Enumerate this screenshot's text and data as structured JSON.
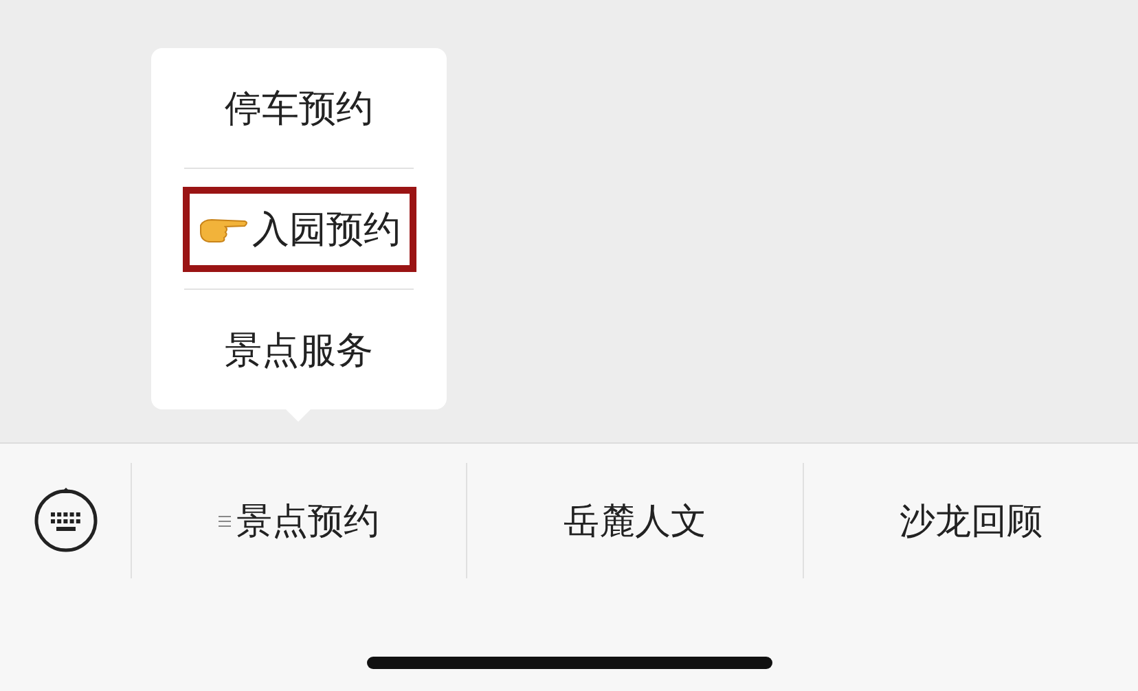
{
  "popup_items": [
    {
      "label": "停车预约",
      "highlighted": false
    },
    {
      "label": "入园预约",
      "highlighted": true
    },
    {
      "label": "景点服务",
      "highlighted": false
    }
  ],
  "menu_tabs": [
    {
      "label": "景点预约",
      "has_submenu": true
    },
    {
      "label": "岳麓人文",
      "has_submenu": false
    },
    {
      "label": "沙龙回顾",
      "has_submenu": false
    }
  ]
}
